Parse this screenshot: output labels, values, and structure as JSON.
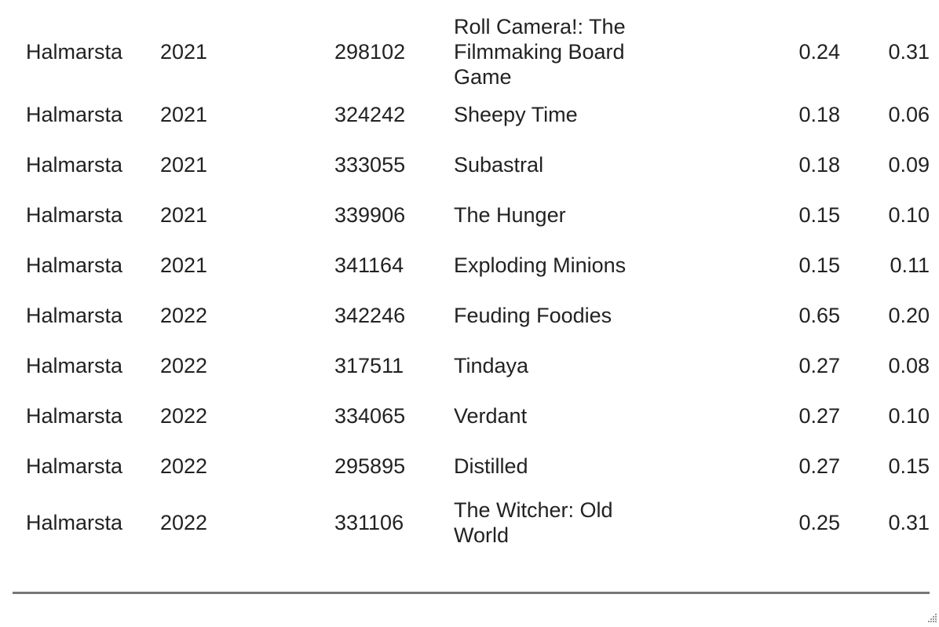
{
  "table": {
    "rows": [
      {
        "publisher": "Halmarsta",
        "year": "2021",
        "id": "298102",
        "name": "Roll Camera!: The Filmmaking Board Game",
        "v1": "0.24",
        "v2": "0.31"
      },
      {
        "publisher": "Halmarsta",
        "year": "2021",
        "id": "324242",
        "name": "Sheepy Time",
        "v1": "0.18",
        "v2": "0.06"
      },
      {
        "publisher": "Halmarsta",
        "year": "2021",
        "id": "333055",
        "name": "Subastral",
        "v1": "0.18",
        "v2": "0.09"
      },
      {
        "publisher": "Halmarsta",
        "year": "2021",
        "id": "339906",
        "name": "The Hunger",
        "v1": "0.15",
        "v2": "0.10"
      },
      {
        "publisher": "Halmarsta",
        "year": "2021",
        "id": "341164",
        "name": "Exploding Minions",
        "v1": "0.15",
        "v2": "0.11"
      },
      {
        "publisher": "Halmarsta",
        "year": "2022",
        "id": "342246",
        "name": "Feuding Foodies",
        "v1": "0.65",
        "v2": "0.20"
      },
      {
        "publisher": "Halmarsta",
        "year": "2022",
        "id": "317511",
        "name": "Tindaya",
        "v1": "0.27",
        "v2": "0.08"
      },
      {
        "publisher": "Halmarsta",
        "year": "2022",
        "id": "334065",
        "name": "Verdant",
        "v1": "0.27",
        "v2": "0.10"
      },
      {
        "publisher": "Halmarsta",
        "year": "2022",
        "id": "295895",
        "name": "Distilled",
        "v1": "0.27",
        "v2": "0.15"
      },
      {
        "publisher": "Halmarsta",
        "year": "2022",
        "id": "331106",
        "name": "The Witcher: Old World",
        "v1": "0.25",
        "v2": "0.31"
      }
    ]
  },
  "icons": {
    "resize": "resize-grip-icon"
  }
}
